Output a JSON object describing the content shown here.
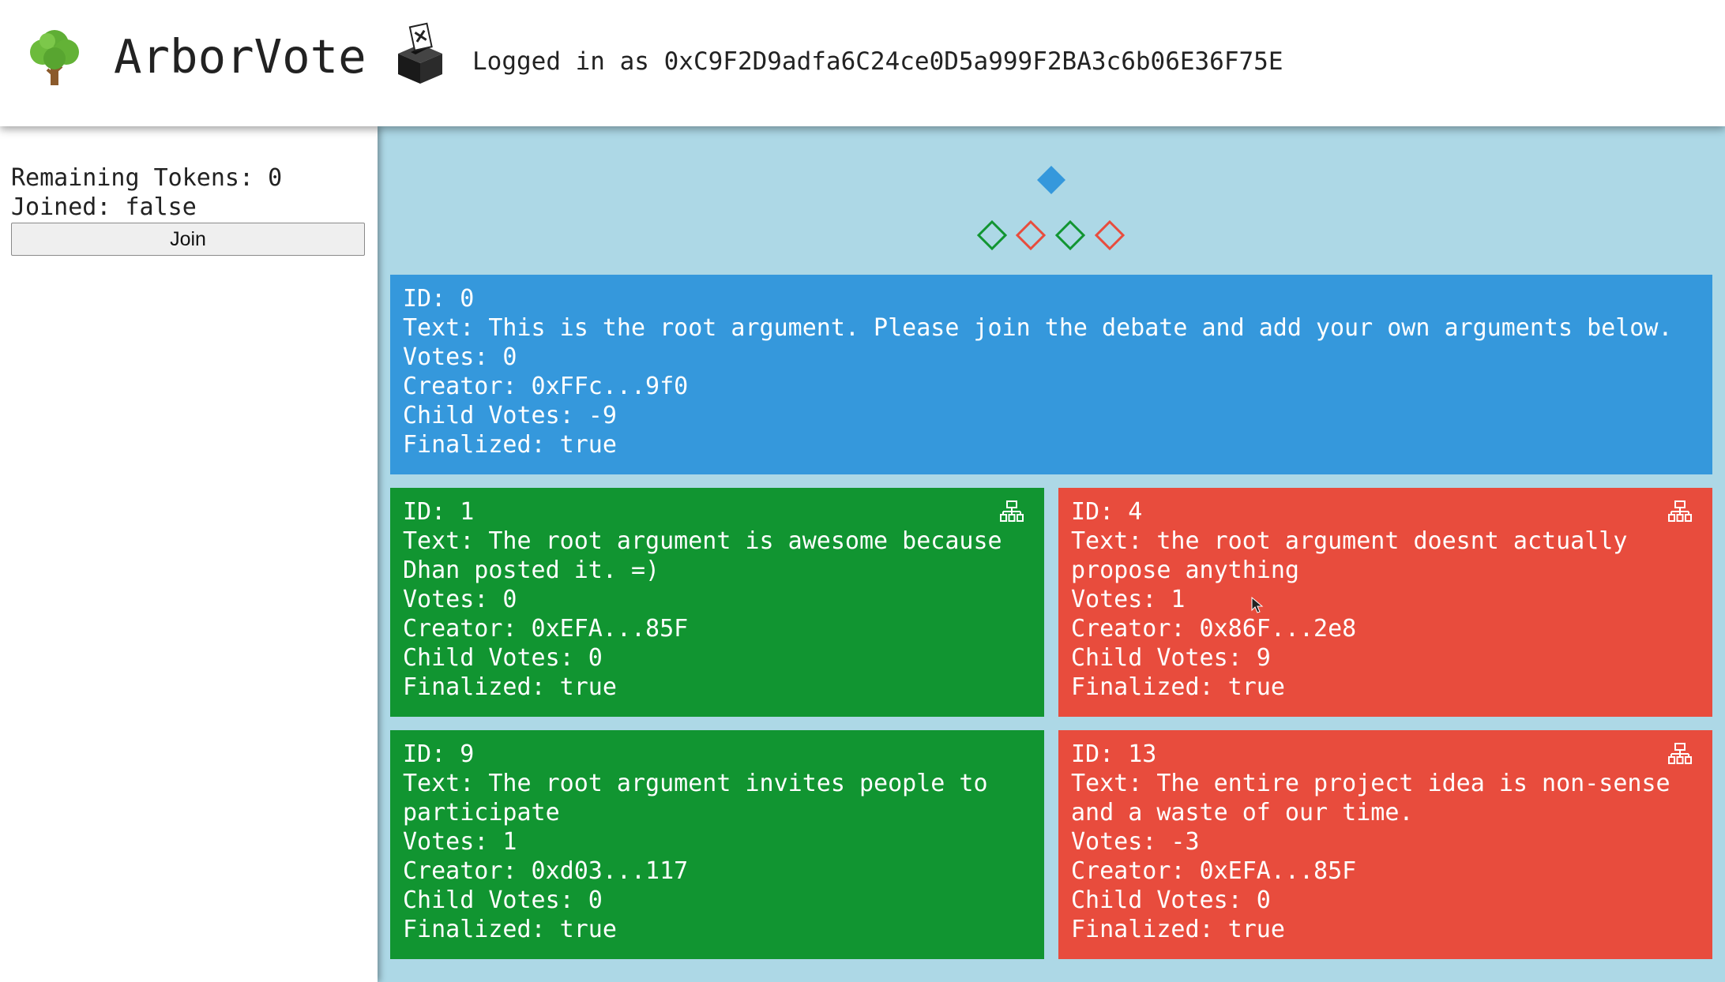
{
  "header": {
    "app_title": "ArborVote",
    "login_text": "Logged in as 0xC9F2D9adfa6C24ce0D5a999F2BA3c6b06E36F75E"
  },
  "sidebar": {
    "remaining_tokens": "Remaining Tokens: 0",
    "joined": "Joined: false",
    "join_label": "Join"
  },
  "colors": {
    "root": "#3598dc",
    "pro": "#119531",
    "con": "#e84c3d",
    "background": "#add8e6"
  },
  "tree_overview": {
    "root": "root",
    "children": [
      "pro",
      "con",
      "pro",
      "con"
    ]
  },
  "root_card": {
    "id": "ID: 0",
    "text": "Text: This is the root argument. Please join the debate and add your own arguments below.",
    "votes": "Votes: 0",
    "creator": "Creator: 0xFFc...9f0",
    "child_votes": "Child Votes: -9",
    "finalized": "Finalized: true"
  },
  "cards": [
    {
      "id": "ID: 1",
      "text": "Text: The root argument is awesome because Dhan posted it. =)",
      "votes": "Votes: 0",
      "creator": "Creator: 0xEFA...85F",
      "child_votes": "Child Votes: 0",
      "finalized": "Finalized: true"
    },
    {
      "id": "ID: 4",
      "text": "Text: the root argument doesnt actually propose anything",
      "votes": "Votes: 1",
      "creator": "Creator: 0x86F...2e8",
      "child_votes": "Child Votes: 9",
      "finalized": "Finalized: true"
    },
    {
      "id": "ID: 9",
      "text": "Text: The root argument invites people to participate",
      "votes": "Votes: 1",
      "creator": "Creator: 0xd03...117",
      "child_votes": "Child Votes: 0",
      "finalized": "Finalized: true"
    },
    {
      "id": "ID: 13",
      "text": "Text: The entire project idea is non-sense and a waste of our time.",
      "votes": "Votes: -3",
      "creator": "Creator: 0xEFA...85F",
      "child_votes": "Child Votes: 0",
      "finalized": "Finalized: true"
    }
  ],
  "icons": {
    "logo": "tree-icon",
    "ballot": "ballot-box-icon",
    "subtree": "sitemap-icon"
  }
}
